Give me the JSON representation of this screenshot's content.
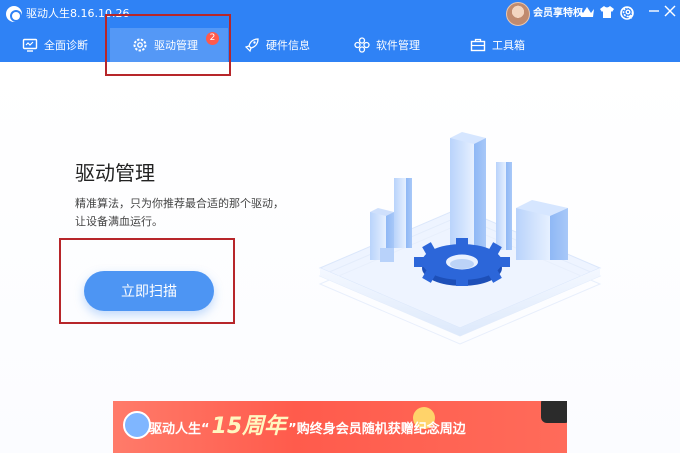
{
  "window": {
    "title": "驱动人生8.16.10.26",
    "vip_label": "会员享特权"
  },
  "nav": {
    "tabs": [
      {
        "label": "全面诊断",
        "icon": "monitor-icon"
      },
      {
        "label": "驱动管理",
        "icon": "gear-icon",
        "badge": "2",
        "active": true
      },
      {
        "label": "硬件信息",
        "icon": "rocket-icon"
      },
      {
        "label": "软件管理",
        "icon": "apps-icon"
      },
      {
        "label": "工具箱",
        "icon": "toolbox-icon"
      }
    ]
  },
  "main": {
    "heading": "驱动管理",
    "description_line1": "精准算法，只为你推荐最合适的那个驱动，",
    "description_line2": "让设备满血运行。",
    "scan_button": "立即扫描"
  },
  "banner": {
    "text_left": "驱动人生“",
    "text_big": "15周年",
    "text_right": "”购终身会员随机获赠纪念周边"
  },
  "colors": {
    "primary": "#2f82f5",
    "button": "#4d95f3",
    "badge": "#ff5a4c",
    "highlight_box": "#b7262a",
    "banner": "#ff5b4c"
  }
}
